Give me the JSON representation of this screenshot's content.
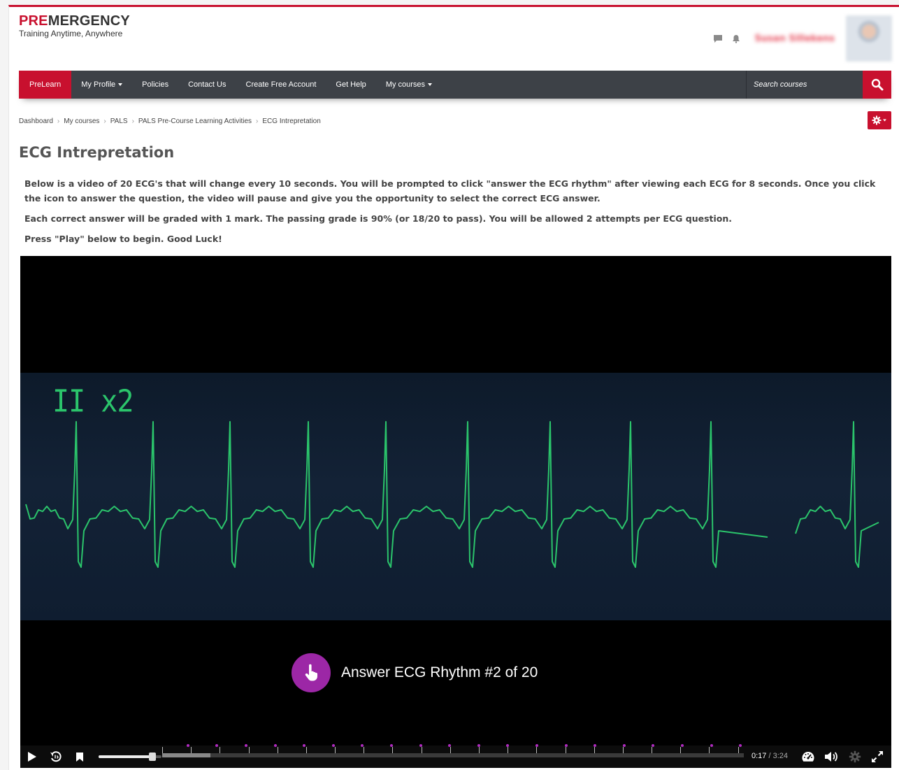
{
  "brand": {
    "logo_pre": "PRE",
    "logo_rest": "MERGENCY",
    "tagline": "Training Anytime, Anywhere",
    "accent": "#c8102e"
  },
  "header": {
    "user_name": "Susan Sillekens"
  },
  "nav": {
    "items": [
      {
        "label": "PreLearn",
        "dropdown": false,
        "active": true
      },
      {
        "label": "My Profile",
        "dropdown": true
      },
      {
        "label": "Policies",
        "dropdown": false
      },
      {
        "label": "Contact Us",
        "dropdown": false
      },
      {
        "label": "Create Free Account",
        "dropdown": false
      },
      {
        "label": "Get Help",
        "dropdown": false
      },
      {
        "label": "My courses",
        "dropdown": true
      }
    ],
    "search_placeholder": "Search courses"
  },
  "breadcrumb": [
    "Dashboard",
    "My courses",
    "PALS",
    "PALS Pre-Course Learning Activities",
    "ECG Intrepretation"
  ],
  "page_title": "ECG Intrepretation",
  "intro": [
    "Below is a video of 20 ECG's that will change every 10 seconds.  You will be prompted to click \"answer the ECG rhythm\" after viewing each ECG for 8 seconds. Once you click the icon to answer the question, the video will pause and give you the opportunity to select the correct ECG answer.",
    "Each correct answer will be graded with 1 mark.  The passing grade is 90% (or 18/20 to pass).  You will be allowed 2 attempts per ECG question.",
    "Press \"Play\" below to begin.  Good Luck!"
  ],
  "video": {
    "ecg_label": "II x2",
    "answer_prompt": "Answer ECG Rhythm #2 of 20",
    "current_time": "0:17",
    "duration": "3:24",
    "progress_fraction": 0.083,
    "volume_fraction": 0.85,
    "interaction_count": 20,
    "trace_color": "#2bc46b",
    "marker_color": "#b02ac0"
  }
}
